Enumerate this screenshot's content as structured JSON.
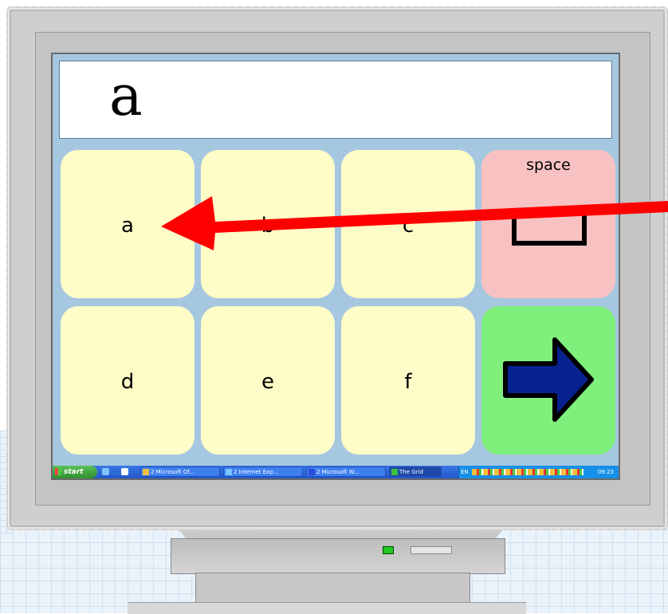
{
  "display": {
    "text": "a"
  },
  "grid": {
    "cells": [
      {
        "label": "a",
        "color": "#fefdc7"
      },
      {
        "label": "b",
        "color": "#fefdc7"
      },
      {
        "label": "c",
        "color": "#fefdc7"
      },
      {
        "label": "space",
        "color": "#f8c2c2"
      },
      {
        "label": "d",
        "color": "#fefdc7"
      },
      {
        "label": "e",
        "color": "#fefdc7"
      },
      {
        "label": "f",
        "color": "#fefdc7"
      },
      {
        "label": "",
        "color": "#80f07c",
        "icon": "right-arrow-icon"
      }
    ]
  },
  "overlay": {
    "icon": "red-pointer-arrow-icon",
    "color": "#ff0000"
  },
  "taskbar": {
    "start_label": "start",
    "windows": [
      {
        "label": "2 Microsoft Of..."
      },
      {
        "label": "2 Internet Exp..."
      },
      {
        "label": "2 Microsoft W..."
      },
      {
        "label": "The Grid",
        "active": true
      }
    ],
    "language": "EN",
    "clock": "09:23"
  }
}
